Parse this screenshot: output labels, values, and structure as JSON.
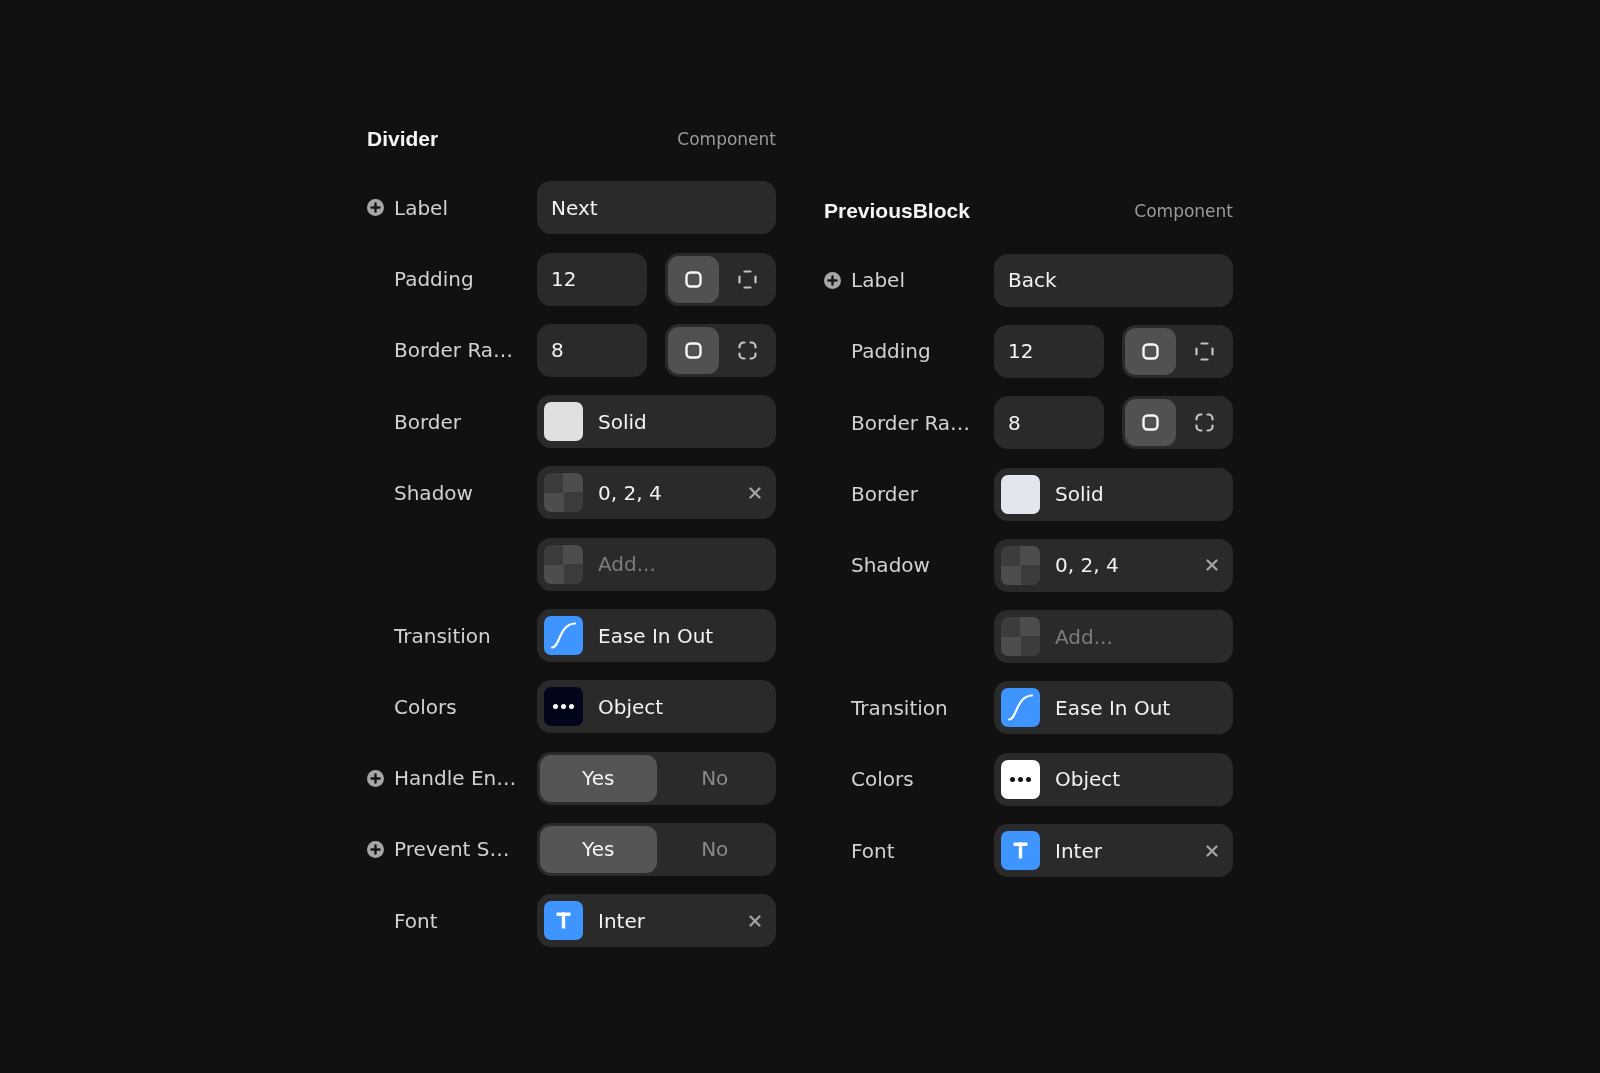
{
  "panels": [
    {
      "title": "Divider",
      "subtitle": "Component",
      "properties": [
        {
          "kind": "text",
          "label": "Label",
          "addable": true,
          "value": "Next"
        },
        {
          "kind": "padding",
          "label": "Padding",
          "addable": false,
          "value": "12",
          "modes": [
            {
              "selected": true
            },
            {
              "selected": false
            }
          ]
        },
        {
          "kind": "radius",
          "label": "Border Ra…",
          "addable": false,
          "value": "8",
          "modes": [
            {
              "selected": true
            },
            {
              "selected": false
            }
          ]
        },
        {
          "kind": "border",
          "label": "Border",
          "addable": false,
          "color": "#e0e0e0",
          "value": "Solid"
        },
        {
          "kind": "shadow",
          "label": "Shadow",
          "addable": false,
          "value": "0, 2, 4",
          "removable": true
        },
        {
          "kind": "add",
          "addable": false,
          "placeholder": "Add..."
        },
        {
          "kind": "transition",
          "label": "Transition",
          "addable": false,
          "value": "Ease In Out"
        },
        {
          "kind": "object",
          "label": "Colors",
          "addable": false,
          "color": "#03061a",
          "value": "Object"
        },
        {
          "kind": "toggle",
          "label": "Handle En…",
          "addable": true,
          "options": [
            {
              "label": "Yes",
              "selected": true
            },
            {
              "label": "No",
              "selected": false
            }
          ]
        },
        {
          "kind": "toggle",
          "label": "Prevent S…",
          "addable": true,
          "options": [
            {
              "label": "Yes",
              "selected": true
            },
            {
              "label": "No",
              "selected": false
            }
          ]
        },
        {
          "kind": "font",
          "label": "Font",
          "addable": false,
          "value": "Inter",
          "removable": true
        }
      ]
    },
    {
      "title": "PreviousBlock",
      "subtitle": "Component",
      "properties": [
        {
          "kind": "text",
          "label": "Label",
          "addable": true,
          "value": "Back"
        },
        {
          "kind": "padding",
          "label": "Padding",
          "addable": false,
          "value": "12",
          "modes": [
            {
              "selected": true
            },
            {
              "selected": false
            }
          ]
        },
        {
          "kind": "radius",
          "label": "Border Ra…",
          "addable": false,
          "value": "8",
          "modes": [
            {
              "selected": true
            },
            {
              "selected": false
            }
          ]
        },
        {
          "kind": "border",
          "label": "Border",
          "addable": false,
          "color": "#e2e6ee",
          "value": "Solid"
        },
        {
          "kind": "shadow",
          "label": "Shadow",
          "addable": false,
          "value": "0, 2, 4",
          "removable": true
        },
        {
          "kind": "add",
          "addable": false,
          "placeholder": "Add..."
        },
        {
          "kind": "transition",
          "label": "Transition",
          "addable": false,
          "value": "Ease In Out"
        },
        {
          "kind": "object",
          "label": "Colors",
          "addable": false,
          "color": "#ffffff",
          "value": "Object"
        },
        {
          "kind": "font",
          "label": "Font",
          "addable": false,
          "value": "Inter",
          "removable": true
        }
      ]
    }
  ]
}
